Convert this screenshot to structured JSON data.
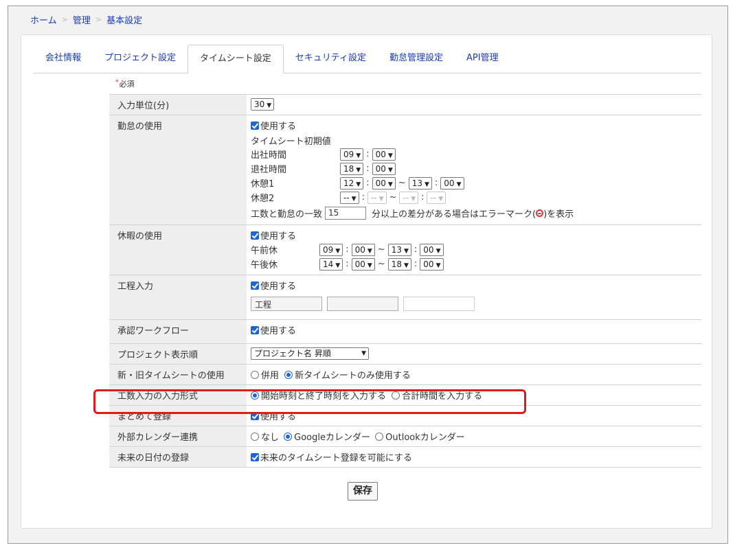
{
  "breadcrumb": [
    "ホーム",
    "管理",
    "基本設定"
  ],
  "breadcrumb_sep": ">",
  "tabs": [
    "会社情報",
    "プロジェクト設定",
    "タイムシート設定",
    "セキュリティ設定",
    "勤怠管理設定",
    "API管理"
  ],
  "active_tab": "タイムシート設定",
  "required_label": "必須",
  "colors": {
    "accent": "#1e64d8",
    "link": "#1a3bb8",
    "highlight": "#e01a1a"
  },
  "rows": {
    "input_unit": {
      "label": "入力単位(分)",
      "value": "30"
    },
    "attendance": {
      "label": "勤怠の使用",
      "checkbox": "使用する",
      "initial_title": "タイムシート初期値",
      "start_label": "出社時間",
      "start_h": "09",
      "start_m": "00",
      "end_label": "退社時間",
      "end_h": "18",
      "end_m": "00",
      "break1_label": "休憩1",
      "break1_sh": "12",
      "break1_sm": "00",
      "break1_eh": "13",
      "break1_em": "00",
      "break2_label": "休憩2",
      "break2_sh": "--",
      "break2_sm": "--",
      "break2_eh": "--",
      "break2_em": "--",
      "match_label": "工数と勤怠の一致",
      "match_value": "15",
      "match_suffix_a": "分以上の差分がある場合はエラーマーク(",
      "match_suffix_b": ")を表示"
    },
    "leave": {
      "label": "休暇の使用",
      "checkbox": "使用する",
      "am_label": "午前休",
      "am_sh": "09",
      "am_sm": "00",
      "am_eh": "13",
      "am_em": "00",
      "pm_label": "午後休",
      "pm_sh": "14",
      "pm_sm": "00",
      "pm_eh": "18",
      "pm_em": "00"
    },
    "process": {
      "label": "工程入力",
      "checkbox": "使用する",
      "field1": "工程",
      "field2": "",
      "field3": ""
    },
    "approval": {
      "label": "承認ワークフロー",
      "checkbox": "使用する"
    },
    "project_order": {
      "label": "プロジェクト表示順",
      "value": "プロジェクト名 昇順"
    },
    "timesheet_version": {
      "label": "新・旧タイムシートの使用",
      "opt1": "併用",
      "opt2": "新タイムシートのみ使用する"
    },
    "input_format": {
      "label": "工数入力の入力形式",
      "opt1": "開始時刻と終了時刻を入力する",
      "opt2": "合計時間を入力する"
    },
    "bulk": {
      "label": "まとめて登録",
      "checkbox": "使用する"
    },
    "calendar": {
      "label": "外部カレンダー連携",
      "opt1": "なし",
      "opt2": "Googleカレンダー",
      "opt3": "Outlookカレンダー"
    },
    "future": {
      "label": "未来の日付の登録",
      "checkbox": "未来のタイムシート登録を可能にする"
    }
  },
  "save_label": "保存"
}
